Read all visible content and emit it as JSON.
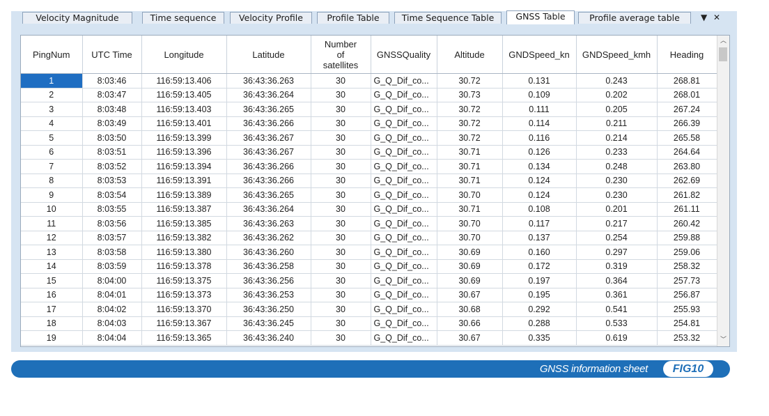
{
  "tabs": [
    {
      "label": "Velocity Magnitude"
    },
    {
      "label": "Time sequence"
    },
    {
      "label": "Velocity Profile"
    },
    {
      "label": "Profile Table"
    },
    {
      "label": "Time Sequence Table"
    },
    {
      "label": "GNSS Table",
      "active": true
    },
    {
      "label": "Profile average table"
    }
  ],
  "window_controls": {
    "dropdown": "▼",
    "close": "✕"
  },
  "table": {
    "headers": {
      "pingnum": "PingNum",
      "utc": "UTC Time",
      "lon": "Longitude",
      "lat": "Latitude",
      "sat_1": "Number",
      "sat_2": "of",
      "sat_3": "satellites",
      "quality": "GNSSQuality",
      "alt": "Altitude",
      "kn": "GNDSpeed_kn",
      "kmh": "GNDSpeed_kmh",
      "heading": "Heading"
    },
    "rows": [
      [
        "1",
        "8:03:46",
        "116:59:13.406",
        "36:43:36.263",
        "30",
        "G_Q_Dif_co...",
        "30.72",
        "0.131",
        "0.243",
        "268.81"
      ],
      [
        "2",
        "8:03:47",
        "116:59:13.405",
        "36:43:36.264",
        "30",
        "G_Q_Dif_co...",
        "30.73",
        "0.109",
        "0.202",
        "268.01"
      ],
      [
        "3",
        "8:03:48",
        "116:59:13.403",
        "36:43:36.265",
        "30",
        "G_Q_Dif_co...",
        "30.72",
        "0.111",
        "0.205",
        "267.24"
      ],
      [
        "4",
        "8:03:49",
        "116:59:13.401",
        "36:43:36.266",
        "30",
        "G_Q_Dif_co...",
        "30.72",
        "0.114",
        "0.211",
        "266.39"
      ],
      [
        "5",
        "8:03:50",
        "116:59:13.399",
        "36:43:36.267",
        "30",
        "G_Q_Dif_co...",
        "30.72",
        "0.116",
        "0.214",
        "265.58"
      ],
      [
        "6",
        "8:03:51",
        "116:59:13.396",
        "36:43:36.267",
        "30",
        "G_Q_Dif_co...",
        "30.71",
        "0.126",
        "0.233",
        "264.64"
      ],
      [
        "7",
        "8:03:52",
        "116:59:13.394",
        "36:43:36.266",
        "30",
        "G_Q_Dif_co...",
        "30.71",
        "0.134",
        "0.248",
        "263.80"
      ],
      [
        "8",
        "8:03:53",
        "116:59:13.391",
        "36:43:36.266",
        "30",
        "G_Q_Dif_co...",
        "30.71",
        "0.124",
        "0.230",
        "262.69"
      ],
      [
        "9",
        "8:03:54",
        "116:59:13.389",
        "36:43:36.265",
        "30",
        "G_Q_Dif_co...",
        "30.70",
        "0.124",
        "0.230",
        "261.82"
      ],
      [
        "10",
        "8:03:55",
        "116:59:13.387",
        "36:43:36.264",
        "30",
        "G_Q_Dif_co...",
        "30.71",
        "0.108",
        "0.201",
        "261.11"
      ],
      [
        "11",
        "8:03:56",
        "116:59:13.385",
        "36:43:36.263",
        "30",
        "G_Q_Dif_co...",
        "30.70",
        "0.117",
        "0.217",
        "260.42"
      ],
      [
        "12",
        "8:03:57",
        "116:59:13.382",
        "36:43:36.262",
        "30",
        "G_Q_Dif_co...",
        "30.70",
        "0.137",
        "0.254",
        "259.88"
      ],
      [
        "13",
        "8:03:58",
        "116:59:13.380",
        "36:43:36.260",
        "30",
        "G_Q_Dif_co...",
        "30.69",
        "0.160",
        "0.297",
        "259.06"
      ],
      [
        "14",
        "8:03:59",
        "116:59:13.378",
        "36:43:36.258",
        "30",
        "G_Q_Dif_co...",
        "30.69",
        "0.172",
        "0.319",
        "258.32"
      ],
      [
        "15",
        "8:04:00",
        "116:59:13.375",
        "36:43:36.256",
        "30",
        "G_Q_Dif_co...",
        "30.69",
        "0.197",
        "0.364",
        "257.73"
      ],
      [
        "16",
        "8:04:01",
        "116:59:13.373",
        "36:43:36.253",
        "30",
        "G_Q_Dif_co...",
        "30.67",
        "0.195",
        "0.361",
        "256.87"
      ],
      [
        "17",
        "8:04:02",
        "116:59:13.370",
        "36:43:36.250",
        "30",
        "G_Q_Dif_co...",
        "30.68",
        "0.292",
        "0.541",
        "255.93"
      ],
      [
        "18",
        "8:04:03",
        "116:59:13.367",
        "36:43:36.245",
        "30",
        "G_Q_Dif_co...",
        "30.66",
        "0.288",
        "0.533",
        "254.81"
      ],
      [
        "19",
        "8:04:04",
        "116:59:13.365",
        "36:43:36.240",
        "30",
        "G_Q_Dif_co...",
        "30.67",
        "0.335",
        "0.619",
        "253.32"
      ]
    ],
    "selected_row": 1
  },
  "scrollbar": {
    "up_icon": "chevron-up-icon",
    "down_icon": "chevron-down-icon",
    "up": "︿",
    "down": "﹀"
  },
  "caption": {
    "text": "GNSS information sheet",
    "badge": "FIG10"
  },
  "colors": {
    "accent": "#1e6fb8",
    "selection": "#1f6ec2",
    "panel": "#d6e4f2"
  }
}
